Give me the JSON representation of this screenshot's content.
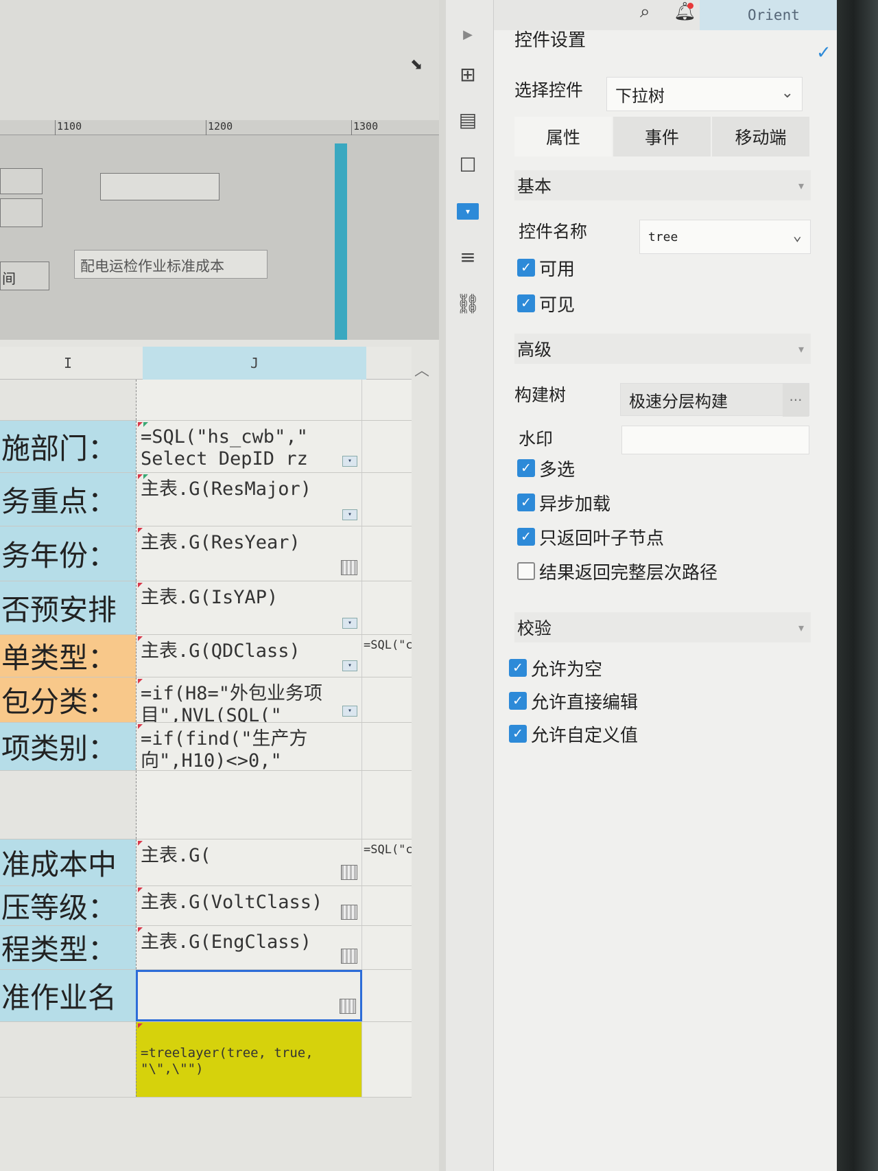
{
  "designer": {
    "ruler": {
      "labels": [
        "1100",
        "1200",
        "1300"
      ]
    },
    "preview_label": "配电运检作业标准成本",
    "preview_partial": "间",
    "columns": {
      "i": "I",
      "j": "J"
    }
  },
  "grid": {
    "rows": [
      {
        "label": "",
        "style": "blank",
        "j": "",
        "k": ""
      },
      {
        "label": "施部门：",
        "style": "blue",
        "j": "=SQL(\"hs_cwb\",\" Select DepID rz",
        "k": ""
      },
      {
        "label": "务重点：",
        "style": "blue",
        "j": "主表.G(ResMajor)",
        "k": ""
      },
      {
        "label": "务年份：",
        "style": "blue",
        "j": "主表.G(ResYear)",
        "k": ""
      },
      {
        "label": "否预安排",
        "style": "blue",
        "j": "主表.G(IsYAP)",
        "k": ""
      },
      {
        "label": "单类型：",
        "style": "orange",
        "j": "主表.G(QDClass)",
        "k": "=SQL(\"cwb\","
      },
      {
        "label": "包分类：",
        "style": "orange",
        "j": "=if(H8=\"外包业务项目\",NVL(SQL(\"",
        "k": ""
      },
      {
        "label": "项类别：",
        "style": "blue",
        "j": "=if(find(\"生产方向\",H10)<>0,\"",
        "k": ""
      },
      {
        "label": "",
        "style": "blank",
        "j": "",
        "k": ""
      },
      {
        "label": "准成本中",
        "style": "blue",
        "j": "主表.G(",
        "k": "=SQL(\"cwb\","
      },
      {
        "label": "压等级：",
        "style": "blue",
        "j": "主表.G(VoltClass)",
        "k": ""
      },
      {
        "label": "程类型：",
        "style": "blue",
        "j": "主表.G(EngClass)",
        "k": ""
      },
      {
        "label": "准作业名",
        "style": "blue",
        "j": "",
        "k": ""
      },
      {
        "label": "",
        "style": "blank",
        "j": "=treelayer(tree, true, \"\\\",\\\"\")",
        "k": ""
      }
    ]
  },
  "header": {
    "user": "Orient"
  },
  "panel": {
    "title": "控件设置",
    "select_control_label": "选择控件",
    "select_control_value": "下拉树",
    "tabs": [
      "属性",
      "事件",
      "移动端"
    ],
    "sections": {
      "basic": "基本",
      "advanced": "高级",
      "validation": "校验"
    },
    "widget_name_label": "控件名称",
    "widget_name_value": "tree",
    "basic_checks": [
      {
        "label": "可用",
        "checked": true
      },
      {
        "label": "可见",
        "checked": true
      }
    ],
    "build_tree_label": "构建树",
    "build_tree_value": "极速分层构建",
    "build_tree_btn": "···",
    "watermark_label": "水印",
    "watermark_value": "",
    "advanced_checks": [
      {
        "label": "多选",
        "checked": true
      },
      {
        "label": "异步加载",
        "checked": true
      },
      {
        "label": "只返回叶子节点",
        "checked": true
      },
      {
        "label": "结果返回完整层次路径",
        "checked": false
      }
    ],
    "validation_checks": [
      {
        "label": "允许为空",
        "checked": true
      },
      {
        "label": "允许直接编辑",
        "checked": true
      },
      {
        "label": "允许自定义值",
        "checked": true
      }
    ]
  },
  "colors": {
    "accent": "#2d8ad8",
    "label_blue": "#b6dde8",
    "label_orange": "#f8c88a",
    "formula_yellow": "#d6d20c"
  }
}
